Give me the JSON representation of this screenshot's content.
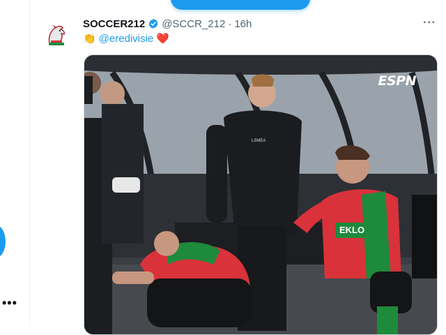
{
  "top_pill": {
    "label": ""
  },
  "tweet": {
    "display_name": "SOCCER212",
    "handle": "@SCCR_212",
    "separator": "·",
    "time": "16h",
    "text_emoji_clap": "👏",
    "mention": "@eredivisie",
    "text_emoji_heart": "❤️"
  },
  "media": {
    "watermark": "ESPN",
    "jersey_sponsor": "EKLO",
    "kit_brand": "LSMEA"
  },
  "icons": {
    "verified": "verified-badge-icon",
    "more": "more-horizontal-icon",
    "rail_more": "more-dots-icon"
  },
  "colors": {
    "accent": "#1d9bf0",
    "kit_red": "#d9323a",
    "kit_green": "#1e8a3c"
  }
}
